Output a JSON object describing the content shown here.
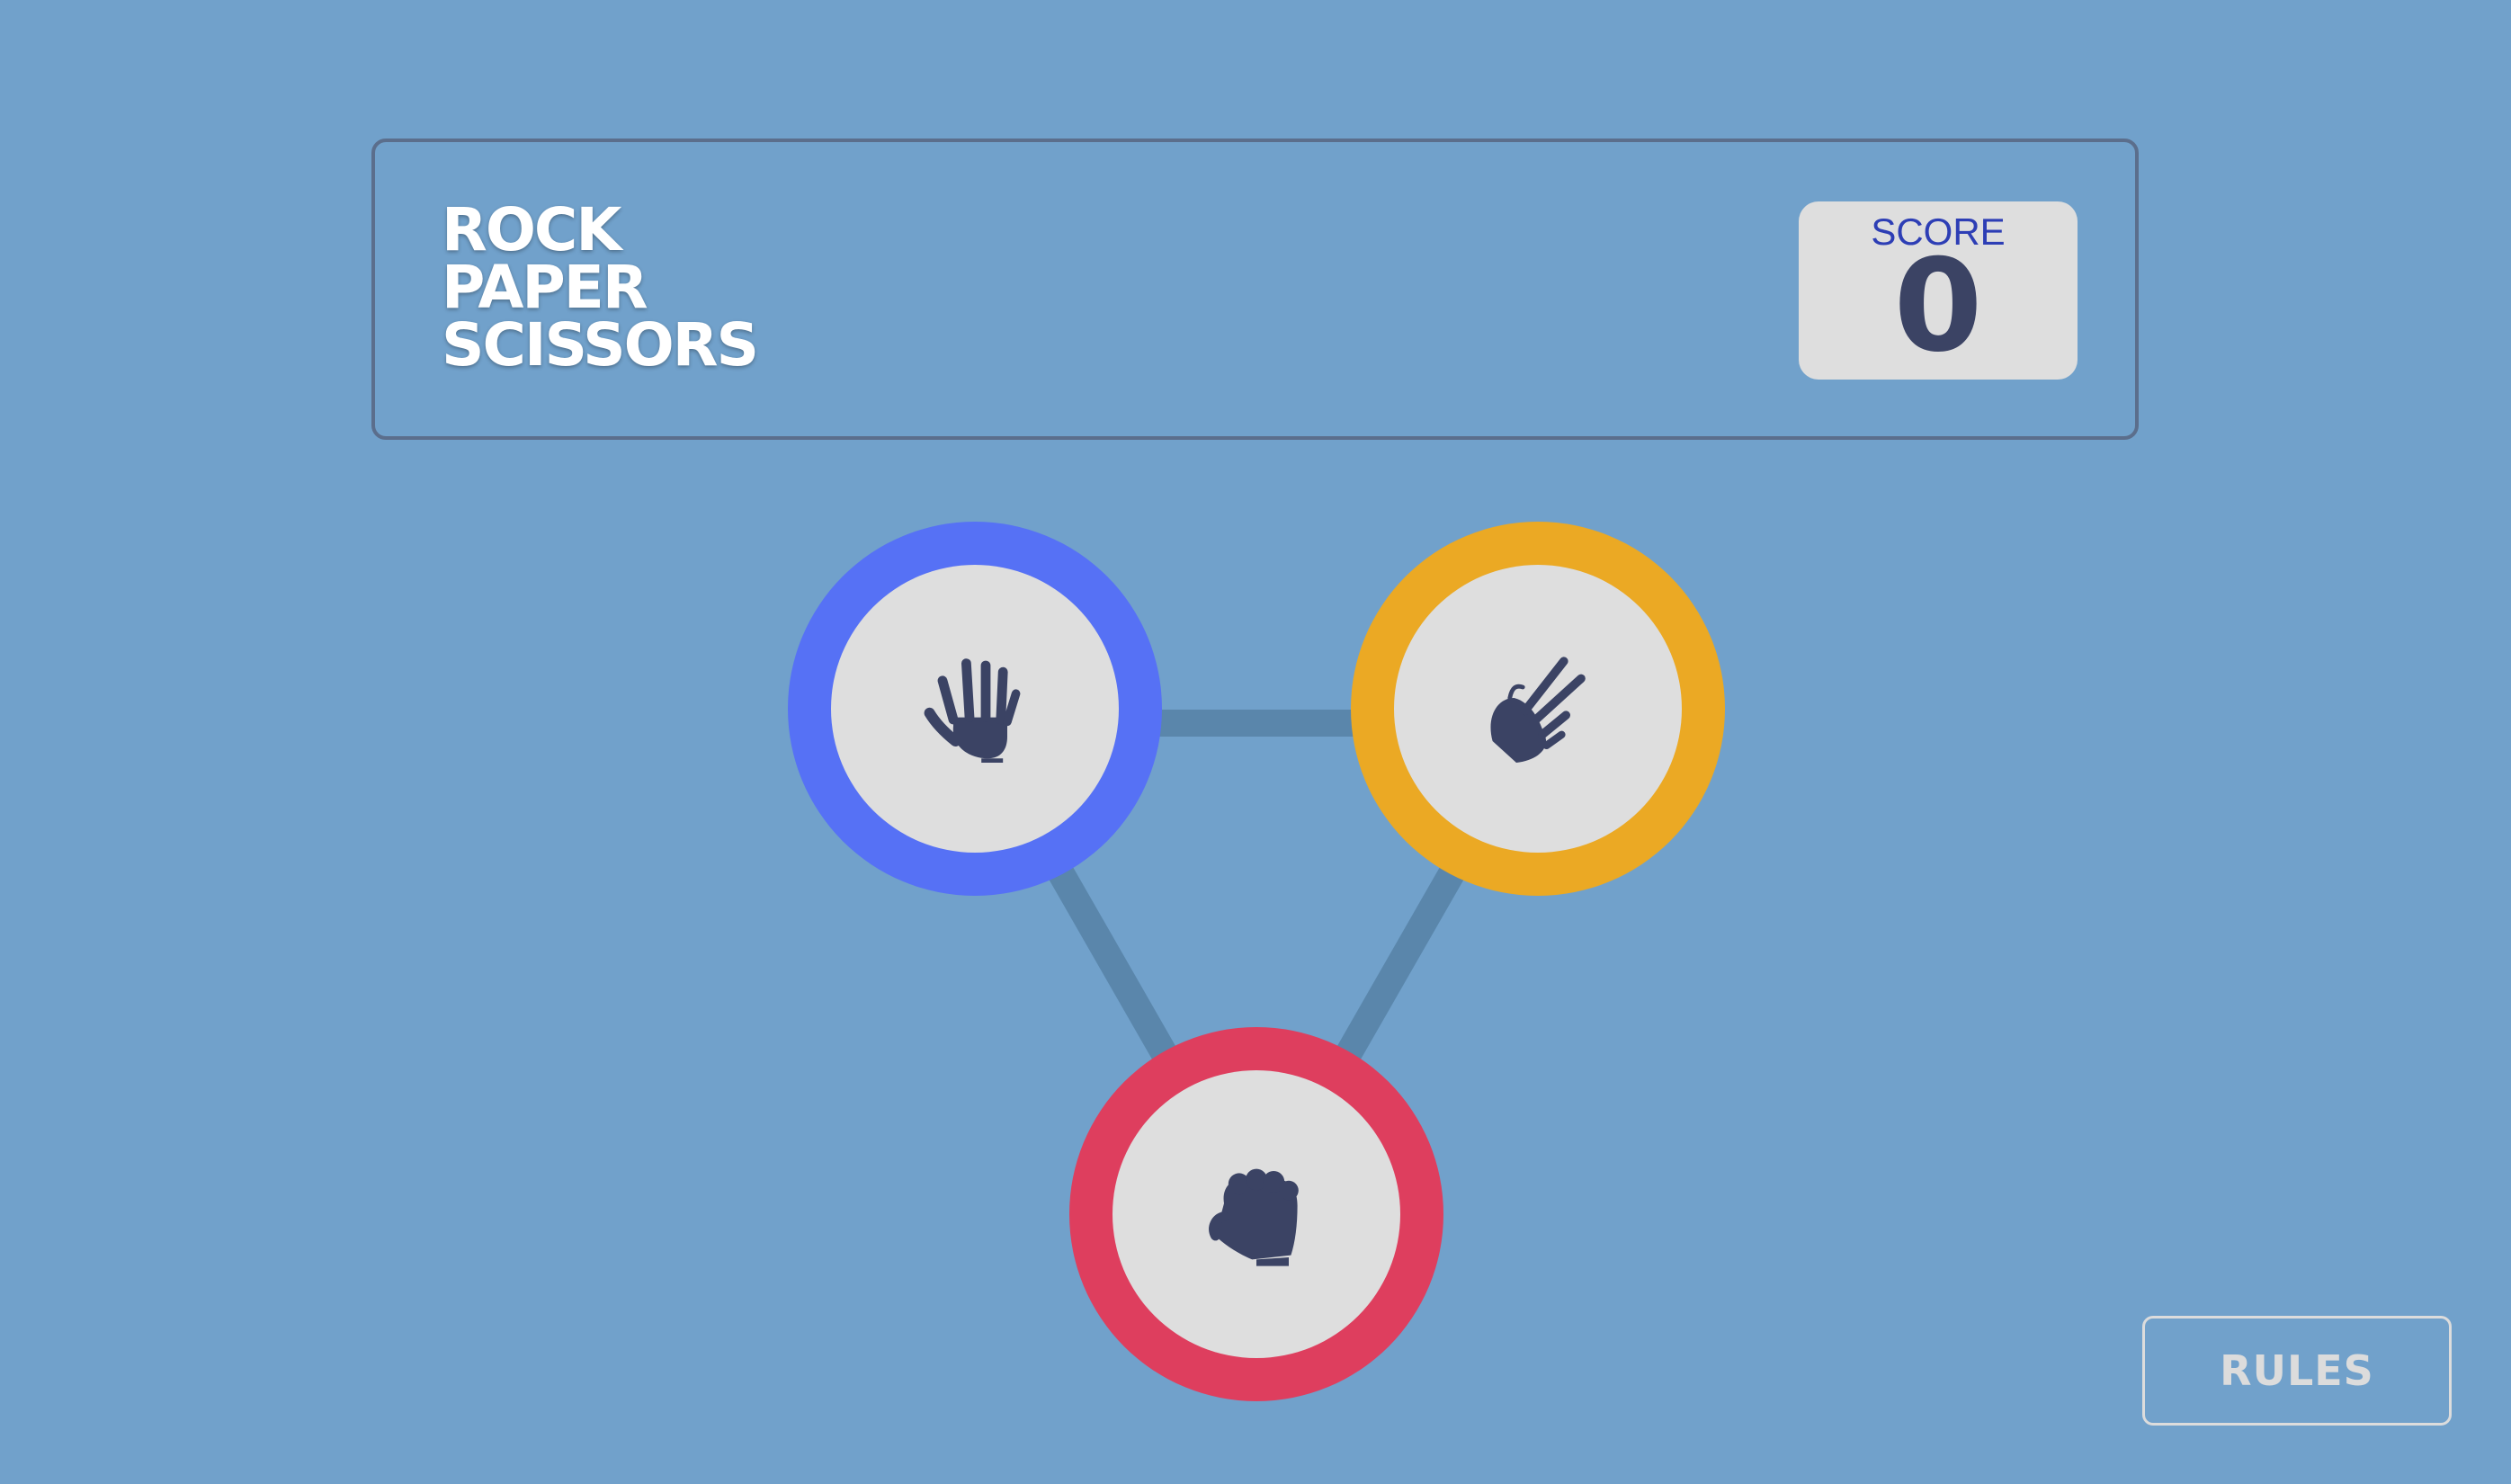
{
  "header": {
    "title_lines": [
      "ROCK",
      "PAPER",
      "SCISSORS"
    ],
    "score_label": "SCORE",
    "score_value": "0"
  },
  "choices": [
    {
      "name": "paper",
      "icon": "paper-hand-icon",
      "ring_color": "#5671f5"
    },
    {
      "name": "scissors",
      "icon": "scissors-hand-icon",
      "ring_color": "#eba924"
    },
    {
      "name": "rock",
      "icon": "rock-fist-icon",
      "ring_color": "#de3e5e"
    }
  ],
  "colors": {
    "background": "#71a1cb",
    "header_border": "#5b6e8c",
    "score_label": "#2d3eb5",
    "icon": "#3b4364",
    "connector": "#5a86ab"
  },
  "rules_button": {
    "label": "RULES"
  }
}
